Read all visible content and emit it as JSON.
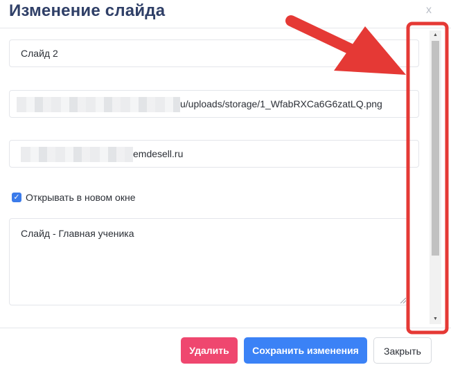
{
  "modal": {
    "title": "Изменение слайда",
    "close_label": "x"
  },
  "form": {
    "slide_name": "Слайд 2",
    "image_url_visible": "u/uploads/storage/1_WfabRXCa6G6zatLQ.png",
    "link_url_visible": "emdesell.ru",
    "open_new_window_label": "Открывать в новом окне",
    "open_new_window_checked": true,
    "description": "Слайд - Главная ученика"
  },
  "footer": {
    "delete_label": "Удалить",
    "save_label": "Сохранить изменения",
    "close_label": "Закрыть"
  },
  "colors": {
    "title": "#2f3f67",
    "delete_button": "#ef476f",
    "save_button": "#3b82f6",
    "checkbox": "#3b7bea",
    "annotation_red": "#e53935"
  },
  "icons": {
    "close": "close-icon",
    "checkbox": "check-icon",
    "scroll_up": "scroll-up-arrow",
    "scroll_down": "scroll-down-arrow"
  }
}
